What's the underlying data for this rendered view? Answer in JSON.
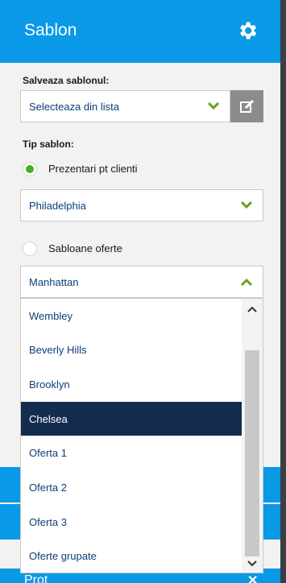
{
  "header": {
    "title": "Sablon",
    "settings_icon": "gear-icon"
  },
  "save_template": {
    "label": "Salveaza sablonul:",
    "select_value": "Selecteaza din lista",
    "edit_icon": "edit-icon"
  },
  "template_type": {
    "label": "Tip sablon:",
    "option_clients": {
      "label": "Prezentari pt clienti",
      "checked": true,
      "selected_value": "Philadelphia"
    },
    "option_offers": {
      "label": "Sabloane oferte",
      "checked": false,
      "selected_value": "Manhattan"
    }
  },
  "dropdown": {
    "options": [
      "Wembley",
      "Beverly Hills",
      "Brooklyn",
      "Chelsea",
      "Oferta 1",
      "Oferta 2",
      "Oferta 3",
      "Oferte grupate"
    ],
    "highlighted": "Chelsea"
  },
  "bottom_section": {
    "label": "Prot",
    "close_icon": "close-icon"
  },
  "colors": {
    "brand_blue": "#0a99e6",
    "chevron_green": "#6aa31b",
    "highlight_navy": "#142d4f"
  }
}
